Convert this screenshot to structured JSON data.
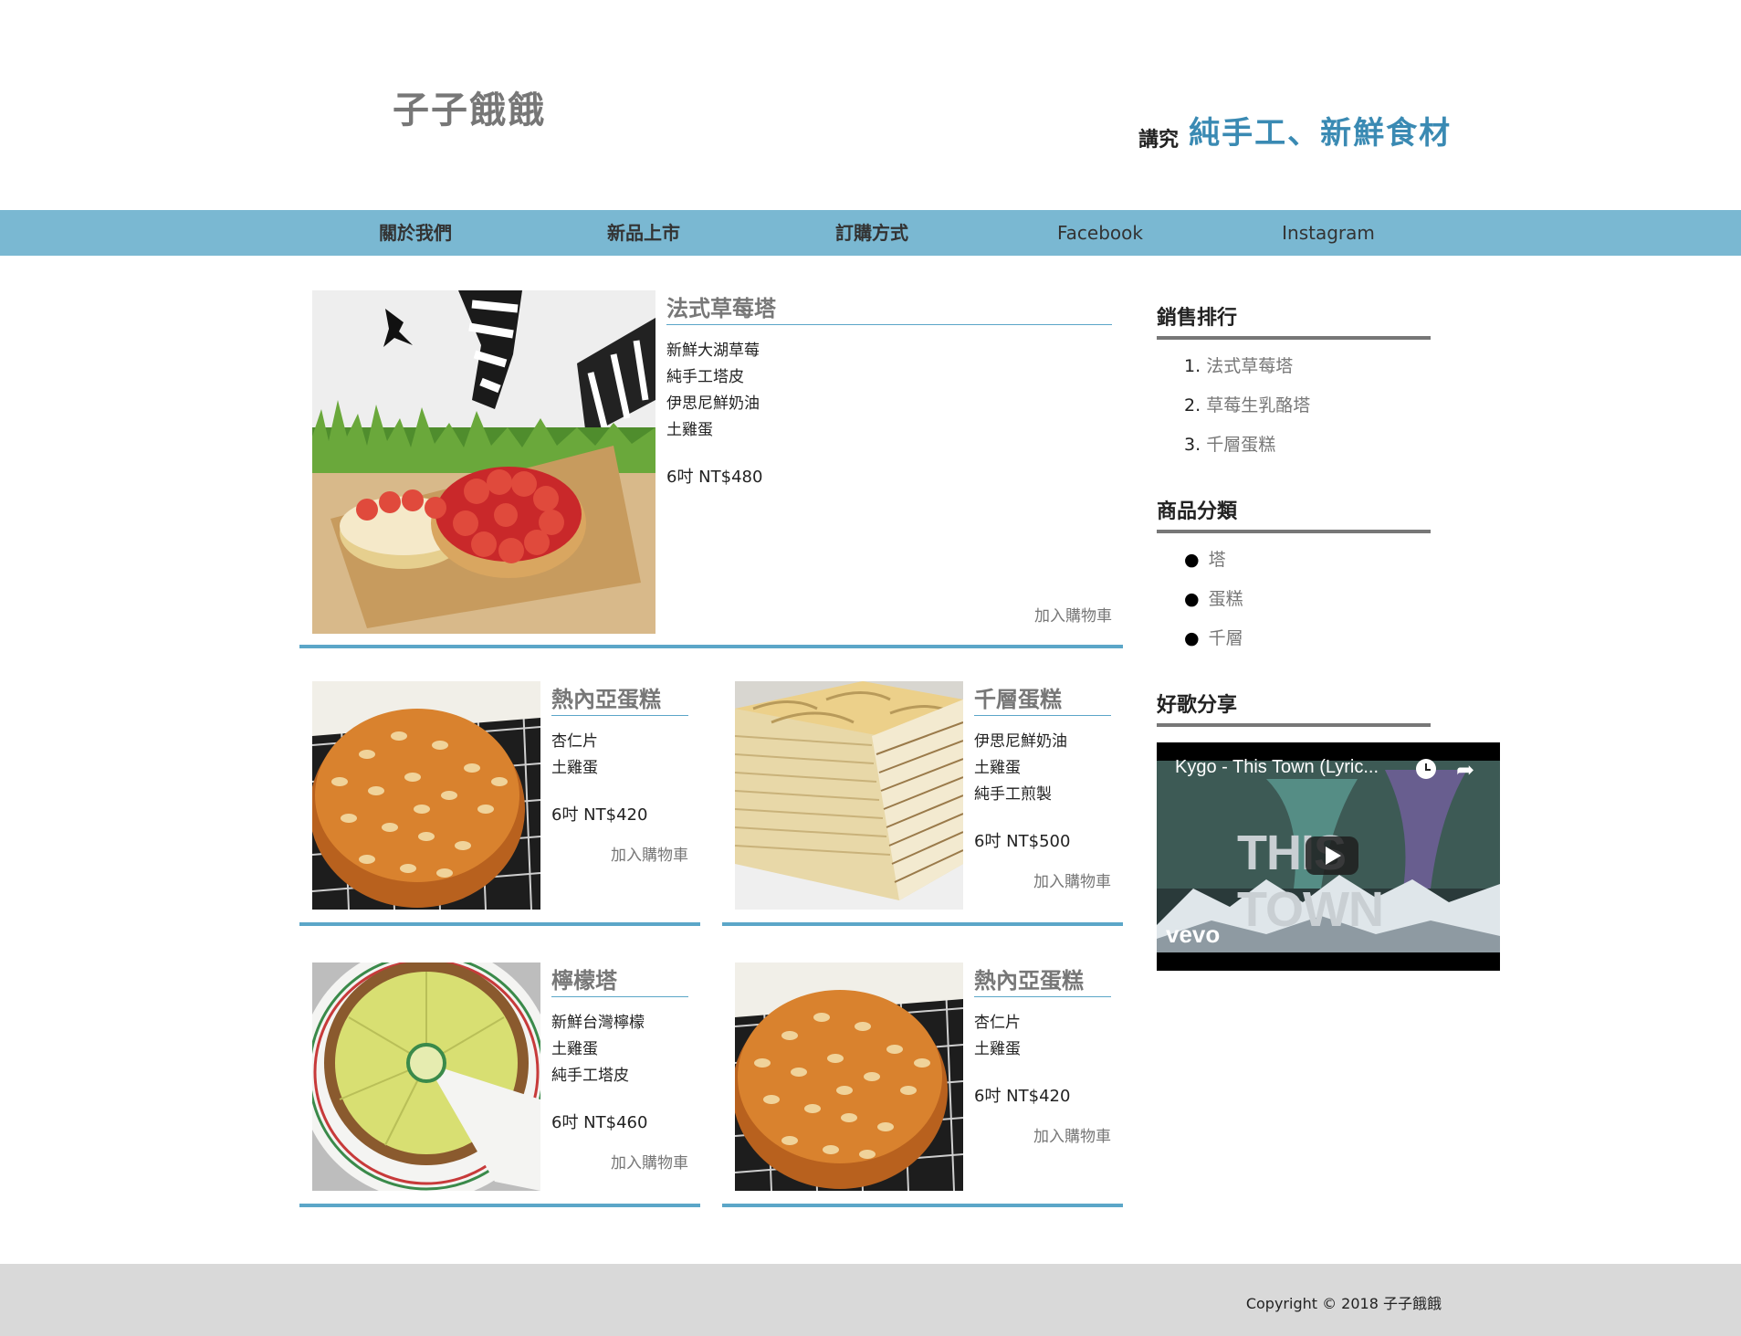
{
  "header": {
    "logo": "子子餓餓",
    "tagline_prefix": "講究",
    "tagline_main": "純手工、新鮮食材"
  },
  "nav": {
    "items": [
      {
        "label": "關於我們"
      },
      {
        "label": "新品上市"
      },
      {
        "label": "訂購方式"
      },
      {
        "label": "Facebook"
      },
      {
        "label": "Instagram"
      }
    ]
  },
  "products": [
    {
      "title": "法式草莓塔",
      "ingredients": [
        "新鮮大湖草莓",
        "純手工塔皮",
        "伊思尼鮮奶油",
        "土雞蛋"
      ],
      "price": "6吋 NT$480",
      "cart": "加入購物車"
    },
    {
      "title": "熱內亞蛋糕",
      "ingredients": [
        "杏仁片",
        "土雞蛋"
      ],
      "price": "6吋 NT$420",
      "cart": "加入購物車"
    },
    {
      "title": "千層蛋糕",
      "ingredients": [
        "伊思尼鮮奶油",
        "土雞蛋",
        "純手工煎製"
      ],
      "price": "6吋 NT$500",
      "cart": "加入購物車"
    },
    {
      "title": "檸檬塔",
      "ingredients": [
        "新鮮台灣檸檬",
        "土雞蛋",
        "純手工塔皮"
      ],
      "price": "6吋 NT$460",
      "cart": "加入購物車"
    },
    {
      "title": "熱內亞蛋糕",
      "ingredients": [
        "杏仁片",
        "土雞蛋"
      ],
      "price": "6吋 NT$420",
      "cart": "加入購物車"
    }
  ],
  "sidebar": {
    "ranking": {
      "heading": "銷售排行",
      "items": [
        {
          "num": "1.",
          "label": "法式草莓塔"
        },
        {
          "num": "2.",
          "label": "草莓生乳酪塔"
        },
        {
          "num": "3.",
          "label": "千層蛋糕"
        }
      ]
    },
    "categories": {
      "heading": "商品分類",
      "items": [
        "塔",
        "蛋糕",
        "千層"
      ]
    },
    "music": {
      "heading": "好歌分享",
      "video_title": "Kygo - This Town (Lyric...",
      "video_overlay_text": "THIS TOWN",
      "video_brand": "vevo"
    }
  },
  "footer": {
    "copyright": "Copyright © 2018 子子餓餓"
  },
  "colors": {
    "nav_bg": "#7ab8d2",
    "accent": "#3a8ab3",
    "card_border": "#5ba6c8",
    "footer_bg": "#d9d9d9"
  }
}
